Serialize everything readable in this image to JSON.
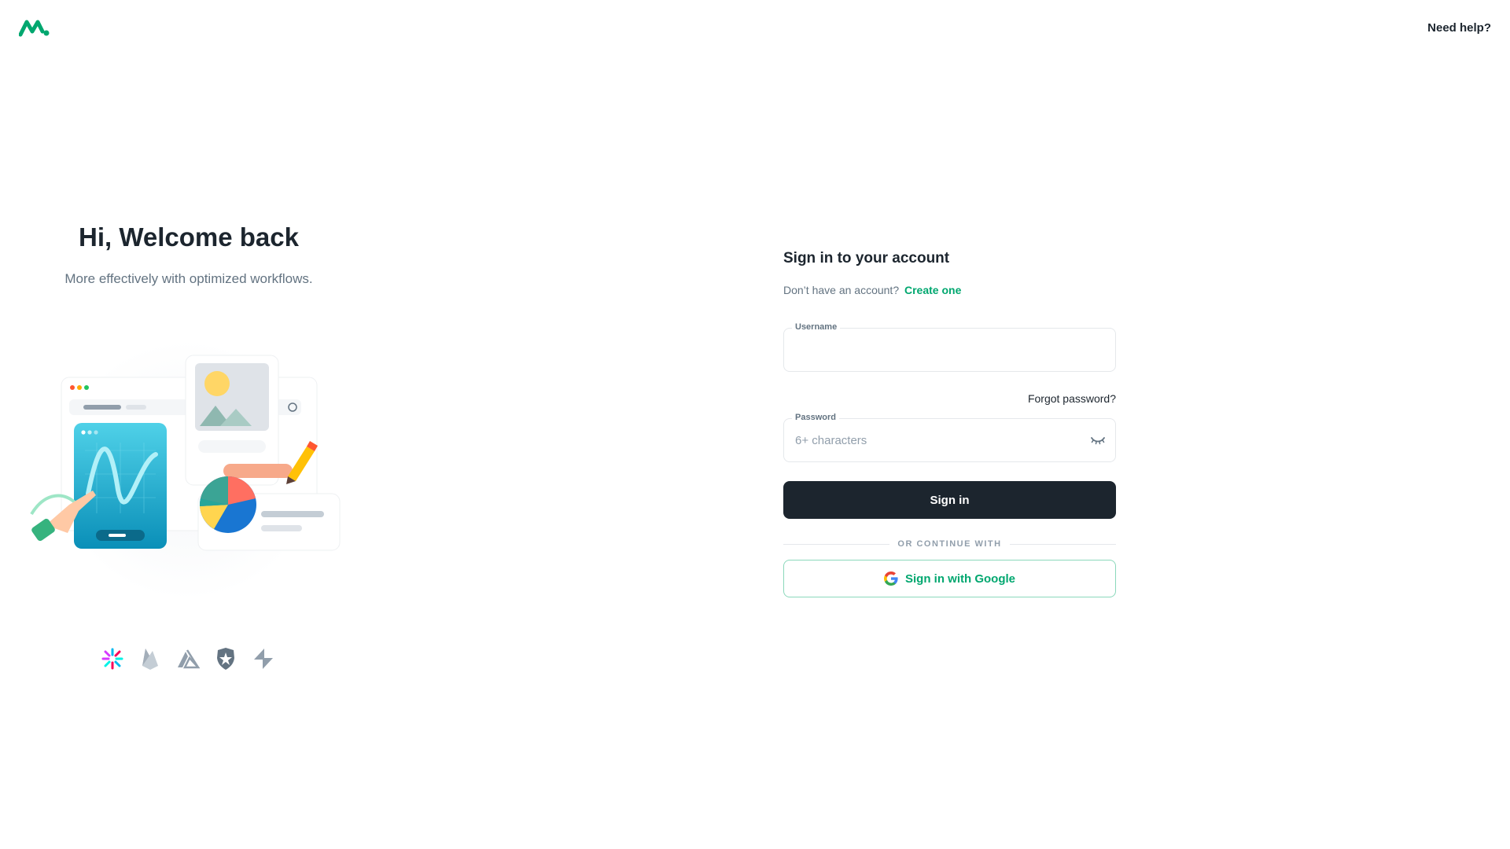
{
  "header": {
    "help_label": "Need help?"
  },
  "left": {
    "title": "Hi, Welcome back",
    "subtitle": "More effectively with optimized workflows.",
    "brands": [
      "jwt-icon",
      "firebase-icon",
      "amplify-icon",
      "auth0-icon",
      "supabase-icon"
    ]
  },
  "form": {
    "title": "Sign in to your account",
    "no_account_text": "Don’t have an account?",
    "create_link": "Create one",
    "username_label": "Username",
    "username_value": "",
    "forgot_password": "Forgot password?",
    "password_label": "Password",
    "password_placeholder": "6+ characters",
    "signin_label": "Sign in",
    "divider_label": "OR CONTINUE WITH",
    "google_label": "Sign in with Google"
  },
  "colors": {
    "primary": "#00a76f",
    "dark": "#1c252e",
    "muted": "#637381"
  }
}
